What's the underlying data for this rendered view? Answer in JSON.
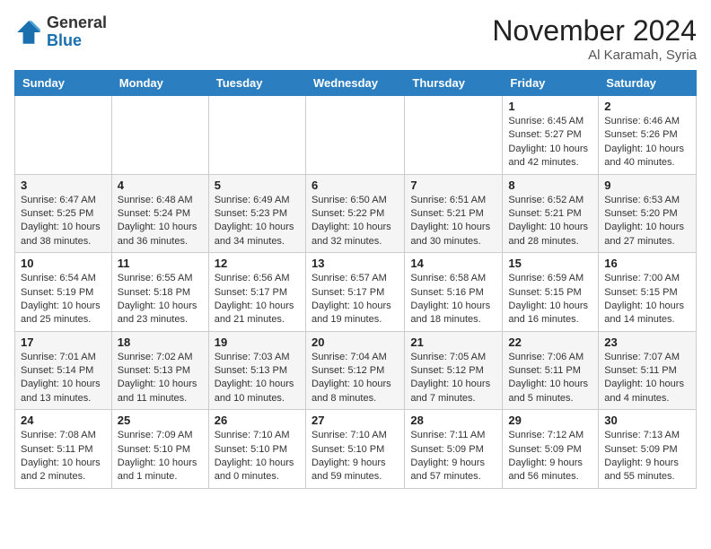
{
  "logo": {
    "general": "General",
    "blue": "Blue"
  },
  "header": {
    "month": "November 2024",
    "location": "Al Karamah, Syria"
  },
  "days_of_week": [
    "Sunday",
    "Monday",
    "Tuesday",
    "Wednesday",
    "Thursday",
    "Friday",
    "Saturday"
  ],
  "weeks": [
    [
      {
        "day": "",
        "info": ""
      },
      {
        "day": "",
        "info": ""
      },
      {
        "day": "",
        "info": ""
      },
      {
        "day": "",
        "info": ""
      },
      {
        "day": "",
        "info": ""
      },
      {
        "day": "1",
        "info": "Sunrise: 6:45 AM\nSunset: 5:27 PM\nDaylight: 10 hours and 42 minutes."
      },
      {
        "day": "2",
        "info": "Sunrise: 6:46 AM\nSunset: 5:26 PM\nDaylight: 10 hours and 40 minutes."
      }
    ],
    [
      {
        "day": "3",
        "info": "Sunrise: 6:47 AM\nSunset: 5:25 PM\nDaylight: 10 hours and 38 minutes."
      },
      {
        "day": "4",
        "info": "Sunrise: 6:48 AM\nSunset: 5:24 PM\nDaylight: 10 hours and 36 minutes."
      },
      {
        "day": "5",
        "info": "Sunrise: 6:49 AM\nSunset: 5:23 PM\nDaylight: 10 hours and 34 minutes."
      },
      {
        "day": "6",
        "info": "Sunrise: 6:50 AM\nSunset: 5:22 PM\nDaylight: 10 hours and 32 minutes."
      },
      {
        "day": "7",
        "info": "Sunrise: 6:51 AM\nSunset: 5:21 PM\nDaylight: 10 hours and 30 minutes."
      },
      {
        "day": "8",
        "info": "Sunrise: 6:52 AM\nSunset: 5:21 PM\nDaylight: 10 hours and 28 minutes."
      },
      {
        "day": "9",
        "info": "Sunrise: 6:53 AM\nSunset: 5:20 PM\nDaylight: 10 hours and 27 minutes."
      }
    ],
    [
      {
        "day": "10",
        "info": "Sunrise: 6:54 AM\nSunset: 5:19 PM\nDaylight: 10 hours and 25 minutes."
      },
      {
        "day": "11",
        "info": "Sunrise: 6:55 AM\nSunset: 5:18 PM\nDaylight: 10 hours and 23 minutes."
      },
      {
        "day": "12",
        "info": "Sunrise: 6:56 AM\nSunset: 5:17 PM\nDaylight: 10 hours and 21 minutes."
      },
      {
        "day": "13",
        "info": "Sunrise: 6:57 AM\nSunset: 5:17 PM\nDaylight: 10 hours and 19 minutes."
      },
      {
        "day": "14",
        "info": "Sunrise: 6:58 AM\nSunset: 5:16 PM\nDaylight: 10 hours and 18 minutes."
      },
      {
        "day": "15",
        "info": "Sunrise: 6:59 AM\nSunset: 5:15 PM\nDaylight: 10 hours and 16 minutes."
      },
      {
        "day": "16",
        "info": "Sunrise: 7:00 AM\nSunset: 5:15 PM\nDaylight: 10 hours and 14 minutes."
      }
    ],
    [
      {
        "day": "17",
        "info": "Sunrise: 7:01 AM\nSunset: 5:14 PM\nDaylight: 10 hours and 13 minutes."
      },
      {
        "day": "18",
        "info": "Sunrise: 7:02 AM\nSunset: 5:13 PM\nDaylight: 10 hours and 11 minutes."
      },
      {
        "day": "19",
        "info": "Sunrise: 7:03 AM\nSunset: 5:13 PM\nDaylight: 10 hours and 10 minutes."
      },
      {
        "day": "20",
        "info": "Sunrise: 7:04 AM\nSunset: 5:12 PM\nDaylight: 10 hours and 8 minutes."
      },
      {
        "day": "21",
        "info": "Sunrise: 7:05 AM\nSunset: 5:12 PM\nDaylight: 10 hours and 7 minutes."
      },
      {
        "day": "22",
        "info": "Sunrise: 7:06 AM\nSunset: 5:11 PM\nDaylight: 10 hours and 5 minutes."
      },
      {
        "day": "23",
        "info": "Sunrise: 7:07 AM\nSunset: 5:11 PM\nDaylight: 10 hours and 4 minutes."
      }
    ],
    [
      {
        "day": "24",
        "info": "Sunrise: 7:08 AM\nSunset: 5:11 PM\nDaylight: 10 hours and 2 minutes."
      },
      {
        "day": "25",
        "info": "Sunrise: 7:09 AM\nSunset: 5:10 PM\nDaylight: 10 hours and 1 minute."
      },
      {
        "day": "26",
        "info": "Sunrise: 7:10 AM\nSunset: 5:10 PM\nDaylight: 10 hours and 0 minutes."
      },
      {
        "day": "27",
        "info": "Sunrise: 7:10 AM\nSunset: 5:10 PM\nDaylight: 9 hours and 59 minutes."
      },
      {
        "day": "28",
        "info": "Sunrise: 7:11 AM\nSunset: 5:09 PM\nDaylight: 9 hours and 57 minutes."
      },
      {
        "day": "29",
        "info": "Sunrise: 7:12 AM\nSunset: 5:09 PM\nDaylight: 9 hours and 56 minutes."
      },
      {
        "day": "30",
        "info": "Sunrise: 7:13 AM\nSunset: 5:09 PM\nDaylight: 9 hours and 55 minutes."
      }
    ]
  ]
}
